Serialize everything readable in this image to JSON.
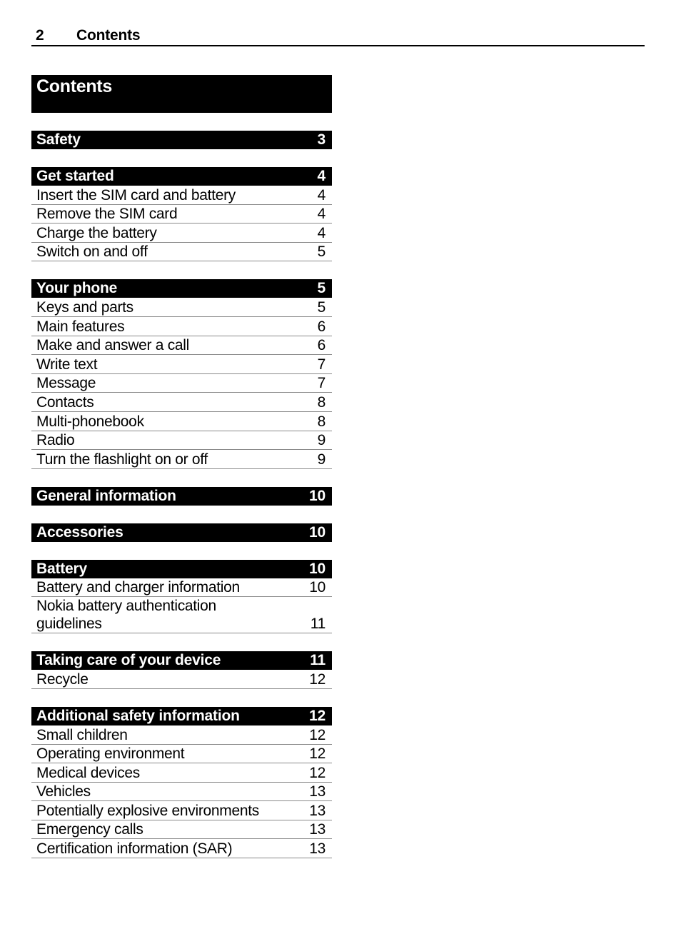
{
  "page_header": {
    "page_number": "2",
    "title": "Contents"
  },
  "toc": {
    "title": "Contents",
    "sections": [
      {
        "title": "Safety",
        "page": "3",
        "entries": []
      },
      {
        "title": "Get started",
        "page": "4",
        "entries": [
          {
            "label": "Insert the SIM card and battery",
            "page": "4"
          },
          {
            "label": "Remove the SIM card",
            "page": "4"
          },
          {
            "label": "Charge the battery",
            "page": "4"
          },
          {
            "label": "Switch on and off",
            "page": "5"
          }
        ]
      },
      {
        "title": "Your phone",
        "page": "5",
        "entries": [
          {
            "label": "Keys and parts",
            "page": "5"
          },
          {
            "label": "Main features",
            "page": "6"
          },
          {
            "label": "Make and answer a call",
            "page": "6"
          },
          {
            "label": "Write text",
            "page": "7"
          },
          {
            "label": "Message",
            "page": "7"
          },
          {
            "label": "Contacts",
            "page": "8"
          },
          {
            "label": "Multi-phonebook",
            "page": "8"
          },
          {
            "label": "Radio",
            "page": "9"
          },
          {
            "label": "Turn the flashlight on or off",
            "page": "9"
          }
        ]
      },
      {
        "title": "General information",
        "page": "10",
        "entries": []
      },
      {
        "title": "Accessories",
        "page": "10",
        "entries": []
      },
      {
        "title": "Battery",
        "page": "10",
        "entries": [
          {
            "label": "Battery and charger information",
            "page": "10"
          },
          {
            "label": "Nokia battery authentication guidelines",
            "page": "11"
          }
        ]
      },
      {
        "title": "Taking care of your device",
        "page": "11",
        "entries": [
          {
            "label": "Recycle",
            "page": "12"
          }
        ]
      },
      {
        "title": "Additional safety information",
        "page": "12",
        "entries": [
          {
            "label": "Small children",
            "page": "12"
          },
          {
            "label": "Operating environment",
            "page": "12"
          },
          {
            "label": "Medical devices",
            "page": "12"
          },
          {
            "label": "Vehicles",
            "page": "13"
          },
          {
            "label": "Potentially explosive environments",
            "page": "13"
          },
          {
            "label": "Emergency calls",
            "page": "13"
          },
          {
            "label": "Certification information (SAR)",
            "page": "13"
          }
        ]
      }
    ]
  }
}
